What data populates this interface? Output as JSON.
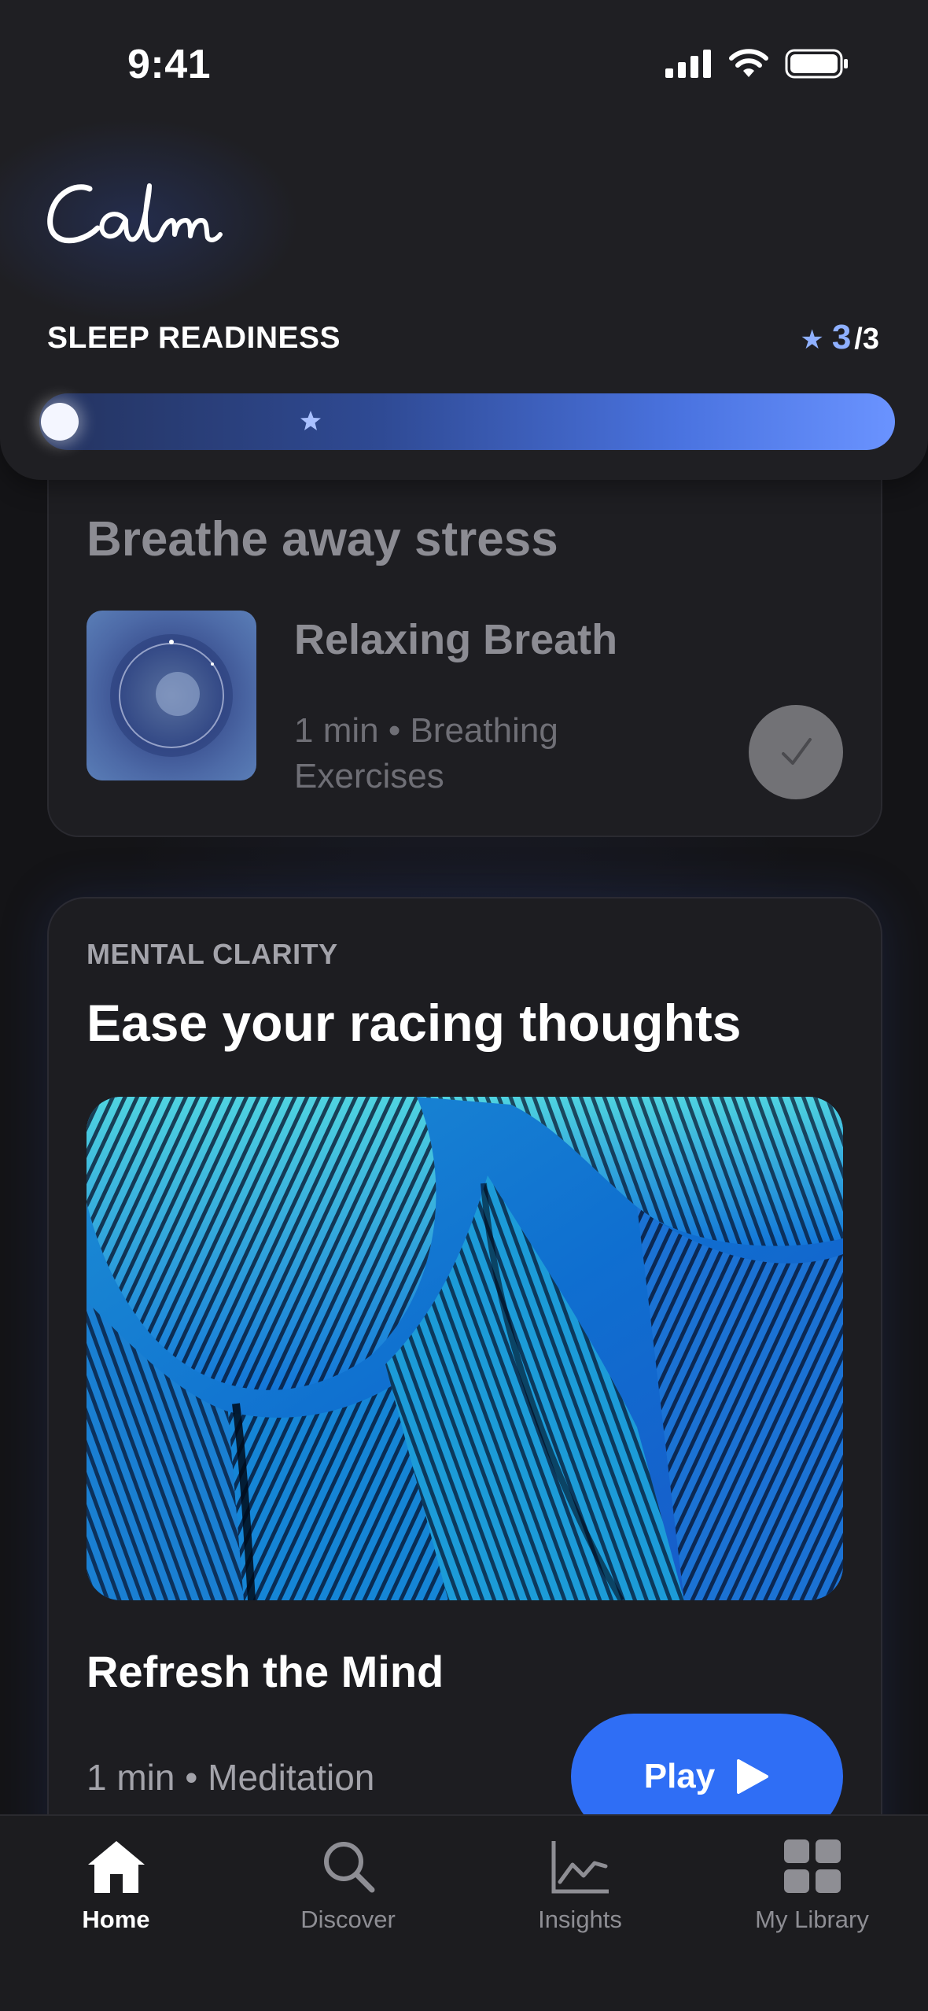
{
  "status_bar": {
    "time": "9:41"
  },
  "header": {
    "logo_text": "Calm",
    "readiness_label": "SLEEP READINESS",
    "score_current": "3",
    "score_total": "/3",
    "progress_fraction": 1.0
  },
  "card_stress": {
    "title": "Breathe away stress",
    "track_title": "Relaxing Breath",
    "meta": "1 min • Breathing Exercises",
    "completed": true
  },
  "card_clarity": {
    "eyebrow": "MENTAL CLARITY",
    "title": "Ease your racing thoughts",
    "track_title": "Refresh the Mind",
    "meta": "1 min • Meditation",
    "play_label": "Play"
  },
  "tabs": [
    {
      "label": "Home",
      "icon": "home-icon",
      "active": true
    },
    {
      "label": "Discover",
      "icon": "search-icon",
      "active": false
    },
    {
      "label": "Insights",
      "icon": "chart-icon",
      "active": false
    },
    {
      "label": "My Library",
      "icon": "grid-icon",
      "active": false
    }
  ],
  "colors": {
    "accent": "#2f6ef5",
    "score_accent": "#8fb0ff",
    "background": "#141417",
    "card": "#1e1e22"
  }
}
